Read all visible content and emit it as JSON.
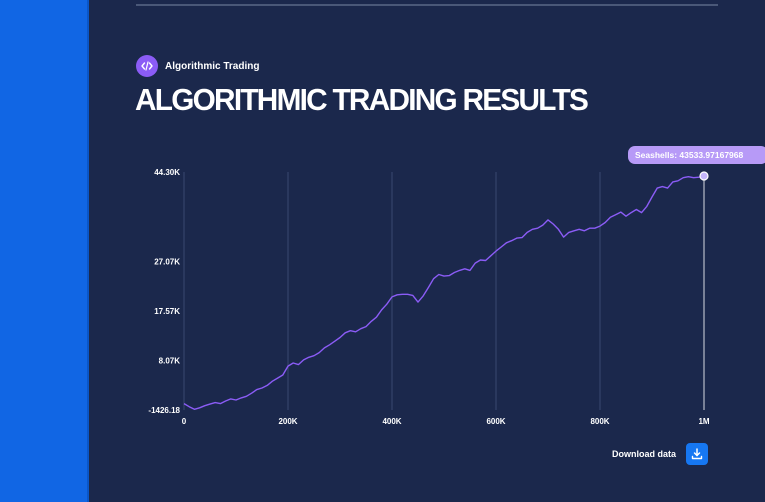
{
  "header": {
    "category_label": "Algorithmic Trading",
    "category_icon": "code-icon",
    "title": "ALGORITHMIC TRADING RESULTS"
  },
  "download": {
    "label": "Download data",
    "icon": "download-icon"
  },
  "colors": {
    "background": "#1b284c",
    "sidebar": "#1166e4",
    "accent": "#8b5cf6",
    "line": "#8b5cf6",
    "grid": "#3a4870",
    "download_button": "#1677f2"
  },
  "chart_data": {
    "type": "line",
    "title": "",
    "xlabel": "",
    "ylabel": "",
    "xlim": [
      0,
      1000000
    ],
    "ylim": [
      -1426.18,
      44300
    ],
    "grid": "vertical",
    "x_ticks": [
      0,
      200000,
      400000,
      600000,
      800000,
      1000000
    ],
    "x_tick_labels": [
      "0",
      "200K",
      "400K",
      "600K",
      "800K",
      "1M"
    ],
    "y_ticks": [
      -1426.18,
      8070,
      17570,
      27070,
      44300
    ],
    "y_tick_labels": [
      "-1426.18",
      "8.07K",
      "17.57K",
      "27.07K",
      "44.30K"
    ],
    "tooltip": "Seashells: 43533.97167968",
    "series": [
      {
        "name": "Seashells",
        "x": [
          0,
          10000,
          20000,
          30000,
          40000,
          50000,
          60000,
          70000,
          80000,
          90000,
          100000,
          110000,
          120000,
          130000,
          140000,
          150000,
          160000,
          170000,
          180000,
          190000,
          200000,
          210000,
          220000,
          230000,
          240000,
          250000,
          260000,
          270000,
          280000,
          290000,
          300000,
          310000,
          320000,
          330000,
          340000,
          350000,
          360000,
          370000,
          380000,
          390000,
          400000,
          410000,
          420000,
          430000,
          440000,
          450000,
          460000,
          470000,
          480000,
          490000,
          500000,
          510000,
          520000,
          530000,
          540000,
          550000,
          560000,
          570000,
          580000,
          590000,
          600000,
          610000,
          620000,
          630000,
          640000,
          650000,
          660000,
          670000,
          680000,
          690000,
          700000,
          710000,
          720000,
          730000,
          740000,
          750000,
          760000,
          770000,
          780000,
          790000,
          800000,
          810000,
          820000,
          830000,
          840000,
          850000,
          860000,
          870000,
          880000,
          890000,
          900000,
          910000,
          920000,
          930000,
          940000,
          950000,
          960000,
          970000,
          980000,
          990000,
          1000000
        ],
        "values": [
          -200,
          -800,
          -1300,
          -1000,
          -600,
          -300,
          0,
          -200,
          300,
          700,
          500,
          900,
          1200,
          1800,
          2500,
          2800,
          3300,
          4100,
          4700,
          5300,
          7000,
          7600,
          7300,
          8200,
          8700,
          9000,
          9600,
          10500,
          11100,
          11800,
          12500,
          13400,
          13800,
          13600,
          14200,
          14600,
          15600,
          16400,
          17800,
          18900,
          20300,
          20700,
          20800,
          20800,
          20600,
          19300,
          20500,
          22100,
          23800,
          24600,
          24300,
          24400,
          25000,
          25400,
          25700,
          25400,
          26800,
          27400,
          27300,
          28200,
          29100,
          29900,
          30700,
          31100,
          31600,
          31700,
          32700,
          33300,
          33500,
          34100,
          35100,
          34300,
          33300,
          31800,
          32700,
          33000,
          33300,
          33000,
          33500,
          33500,
          33900,
          34600,
          35600,
          36100,
          36600,
          35800,
          36500,
          37100,
          36500,
          37700,
          39500,
          41200,
          41500,
          41200,
          42400,
          42600,
          43200,
          43400,
          43200,
          43300,
          43534
        ]
      }
    ]
  }
}
